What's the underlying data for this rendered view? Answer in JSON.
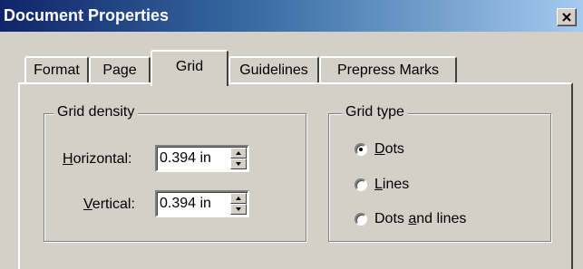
{
  "window": {
    "title": "Document Properties",
    "close_label": "×"
  },
  "tabs": [
    {
      "label": "Format",
      "active": false
    },
    {
      "label": "Page",
      "active": false
    },
    {
      "label": "Grid",
      "active": true
    },
    {
      "label": "Guidelines",
      "active": false
    },
    {
      "label": "Prepress Marks",
      "active": false
    }
  ],
  "grid_density": {
    "legend": "Grid density",
    "horizontal": {
      "label_mnemonic": "H",
      "label_rest": "orizontal:",
      "value": "0.394 in"
    },
    "vertical": {
      "label_mnemonic": "V",
      "label_rest": "ertical:",
      "value": "0.394 in"
    }
  },
  "grid_type": {
    "legend": "Grid type",
    "options": [
      {
        "pre": "",
        "mnemonic": "D",
        "post": "ots",
        "selected": true
      },
      {
        "pre": "",
        "mnemonic": "L",
        "post": "ines",
        "selected": false
      },
      {
        "pre": "Dots ",
        "mnemonic": "a",
        "post": "nd lines",
        "selected": false
      }
    ]
  },
  "colors": {
    "face": "#d4d0c8",
    "title_start": "#10246a",
    "title_end": "#a6caf0"
  }
}
